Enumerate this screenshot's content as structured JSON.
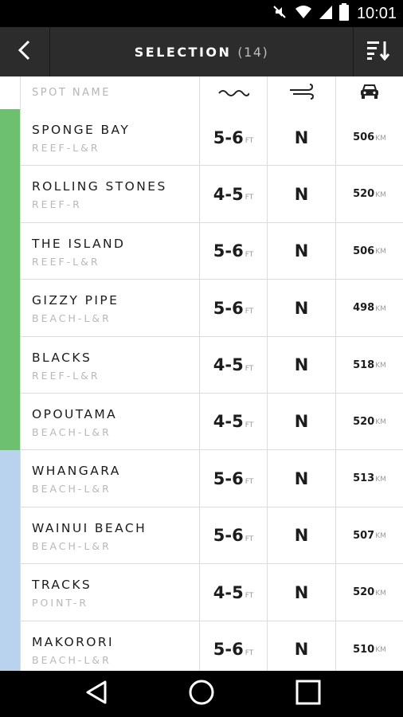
{
  "status_bar": {
    "time": "10:01",
    "icons": [
      "mute-icon",
      "wifi-icon",
      "signal-icon",
      "battery-icon"
    ]
  },
  "app_bar": {
    "title": "SELECTION",
    "count": "(14)",
    "back_icon": "chevron-left-icon",
    "sort_icon": "sort-icon"
  },
  "table": {
    "header": {
      "spot_name": "SPOT NAME",
      "swell_icon": "wave-icon",
      "wind_icon": "wind-icon",
      "distance_icon": "car-icon"
    },
    "rows": [
      {
        "name": "SPONGE BAY",
        "type": "REEF-L&R",
        "swell": "5-6",
        "swell_unit": "FT",
        "wind": "N",
        "distance": "506",
        "distance_unit": "KM",
        "strip_color": "#6cc070"
      },
      {
        "name": "ROLLING STONES",
        "type": "REEF-R",
        "swell": "4-5",
        "swell_unit": "FT",
        "wind": "N",
        "distance": "520",
        "distance_unit": "KM",
        "strip_color": "#6cc070"
      },
      {
        "name": "THE ISLAND",
        "type": "REEF-L&R",
        "swell": "5-6",
        "swell_unit": "FT",
        "wind": "N",
        "distance": "506",
        "distance_unit": "KM",
        "strip_color": "#6cc070"
      },
      {
        "name": "GIZZY PIPE",
        "type": "BEACH-L&R",
        "swell": "5-6",
        "swell_unit": "FT",
        "wind": "N",
        "distance": "498",
        "distance_unit": "KM",
        "strip_color": "#6cc070"
      },
      {
        "name": "BLACKS",
        "type": "REEF-L&R",
        "swell": "4-5",
        "swell_unit": "FT",
        "wind": "N",
        "distance": "518",
        "distance_unit": "KM",
        "strip_color": "#6cc070"
      },
      {
        "name": "OPOUTAMA",
        "type": "BEACH-L&R",
        "swell": "4-5",
        "swell_unit": "FT",
        "wind": "N",
        "distance": "520",
        "distance_unit": "KM",
        "strip_color": "#6cc070"
      },
      {
        "name": "WHANGARA",
        "type": "BEACH-L&R",
        "swell": "5-6",
        "swell_unit": "FT",
        "wind": "N",
        "distance": "513",
        "distance_unit": "KM",
        "strip_color": "#b9d3ef"
      },
      {
        "name": "WAINUI BEACH",
        "type": "BEACH-L&R",
        "swell": "5-6",
        "swell_unit": "FT",
        "wind": "N",
        "distance": "507",
        "distance_unit": "KM",
        "strip_color": "#b9d3ef"
      },
      {
        "name": "TRACKS",
        "type": "POINT-R",
        "swell": "4-5",
        "swell_unit": "FT",
        "wind": "N",
        "distance": "520",
        "distance_unit": "KM",
        "strip_color": "#b9d3ef"
      },
      {
        "name": "MAKORORI",
        "type": "BEACH-L&R",
        "swell": "5-6",
        "swell_unit": "FT",
        "wind": "N",
        "distance": "510",
        "distance_unit": "KM",
        "strip_color": "#b9d3ef"
      }
    ]
  },
  "nav_bar": {
    "back_icon": "nav-back-icon",
    "home_icon": "nav-home-icon",
    "recents_icon": "nav-recents-icon"
  },
  "colors": {
    "app_bar": "#2c2c2c",
    "good_strip": "#6cc070",
    "fair_strip": "#b9d3ef"
  }
}
